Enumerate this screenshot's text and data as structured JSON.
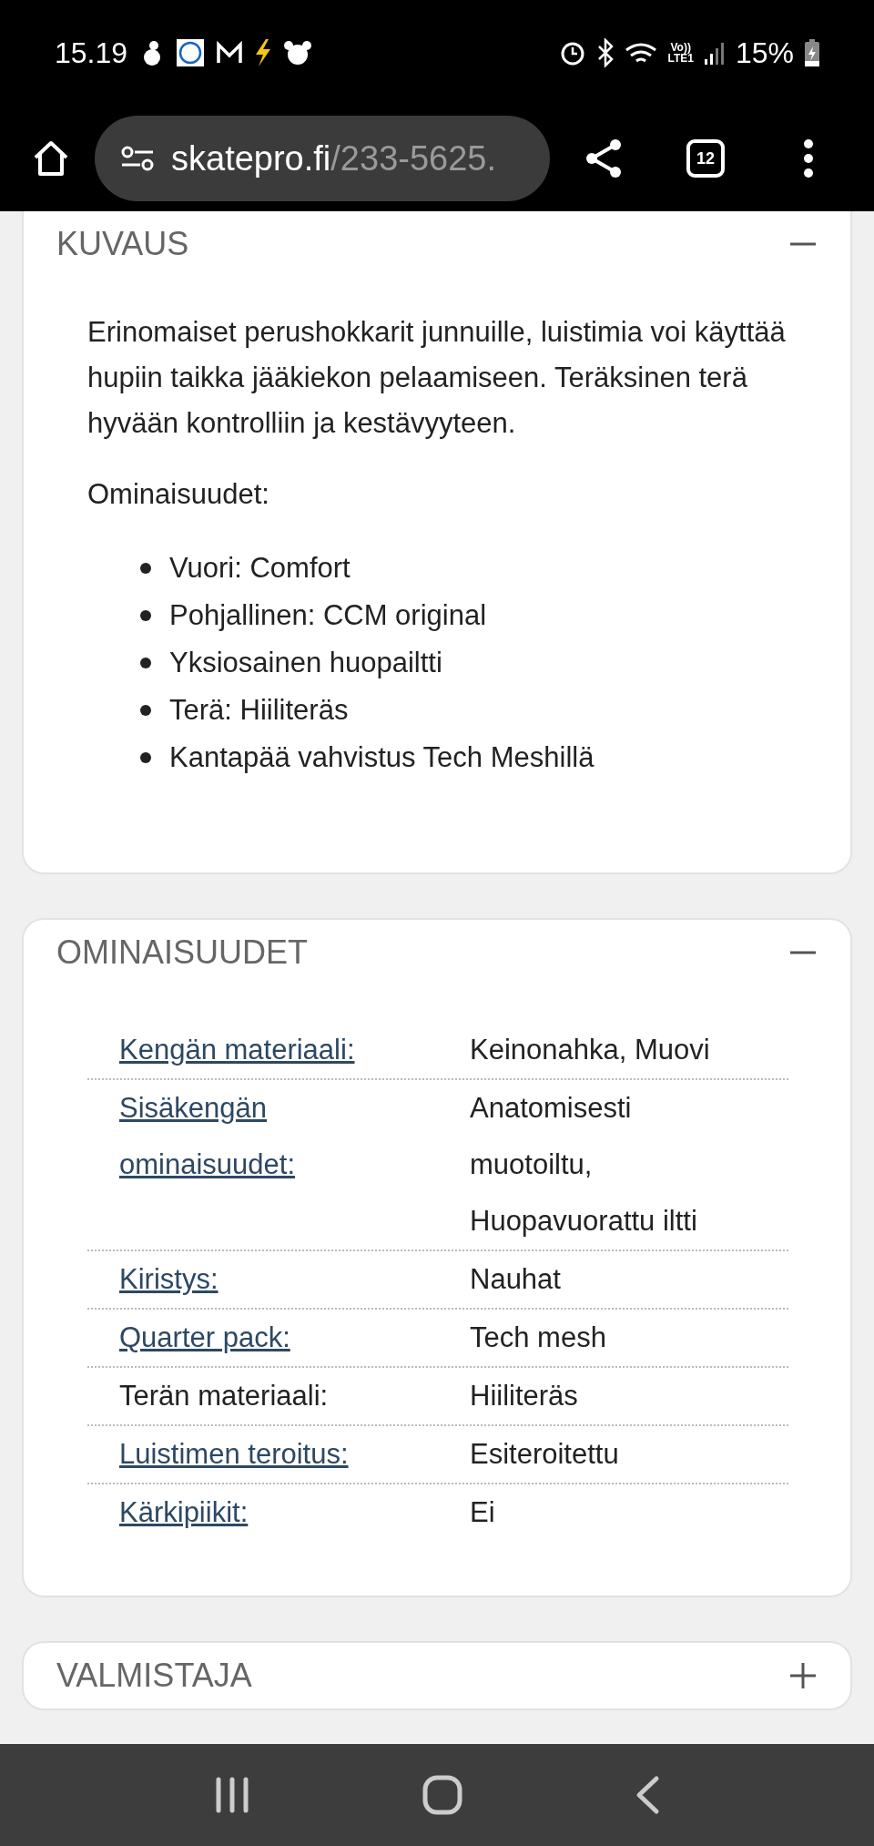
{
  "status_bar": {
    "time": "15.19",
    "volte": "Vo))",
    "network": "LTE1",
    "battery": "15%"
  },
  "browser_bar": {
    "url_host": "skatepro.fi",
    "url_path": "/233-5625.",
    "tab_count": "12"
  },
  "sections": [
    {
      "kind": "description",
      "title": "KUVAUS",
      "expanded": true,
      "paragraph": "Erinomaiset perushokkarit junnuille, luistimia voi käyttää hupiin taikka jääkiekon pelaamiseen. Teräksinen terä hyvään kontrolliin ja kestävyyteen.",
      "features_heading": "Ominaisuudet:",
      "bullets": [
        "Vuori: Comfort",
        "Pohjallinen: CCM original",
        "Yksiosainen huopailtti",
        "Terä: Hiiliteräs",
        "Kantapää vahvistus Tech Meshillä"
      ]
    },
    {
      "kind": "specs",
      "title": "OMINAISUUDET",
      "expanded": true,
      "rows": [
        {
          "label": "Kengän materiaali:",
          "link": true,
          "value": "Keinonahka, Muovi"
        },
        {
          "label": "Sisäkengän ominaisuudet:",
          "link": true,
          "value": "Anatomisesti muotoiltu, Huopavuorattu iltti"
        },
        {
          "label": "Kiristys:",
          "link": true,
          "value": "Nauhat"
        },
        {
          "label": "Quarter pack:",
          "link": true,
          "value": "Tech mesh"
        },
        {
          "label": "Terän materiaali:",
          "link": false,
          "value": "Hiiliteräs"
        },
        {
          "label": "Luistimen teroitus:",
          "link": true,
          "value": "Esiteroitettu"
        },
        {
          "label": "Kärkipiikit:",
          "link": true,
          "value": "Ei"
        }
      ]
    },
    {
      "title": "VALMISTAJA",
      "expanded": false
    }
  ]
}
